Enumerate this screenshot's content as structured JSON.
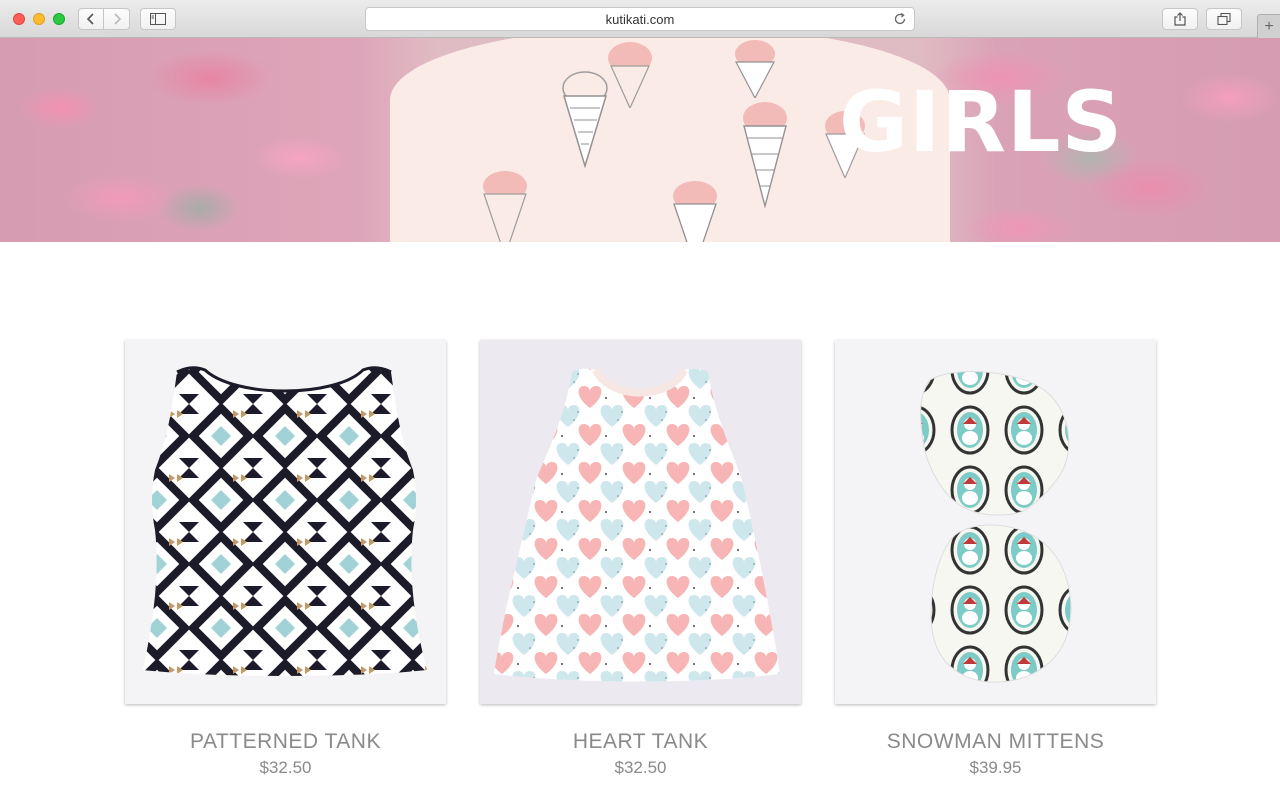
{
  "browser": {
    "url": "kutikati.com"
  },
  "hero": {
    "title": "GIRLS"
  },
  "products": [
    {
      "name": "PATTERNED TANK",
      "price": "$32.50"
    },
    {
      "name": "HEART TANK",
      "price": "$32.50"
    },
    {
      "name": "SNOWMAN MITTENS",
      "price": "$39.95"
    }
  ],
  "colors": {
    "text_gray": "#8a8a8a",
    "hero_pink": "#e9437a"
  }
}
